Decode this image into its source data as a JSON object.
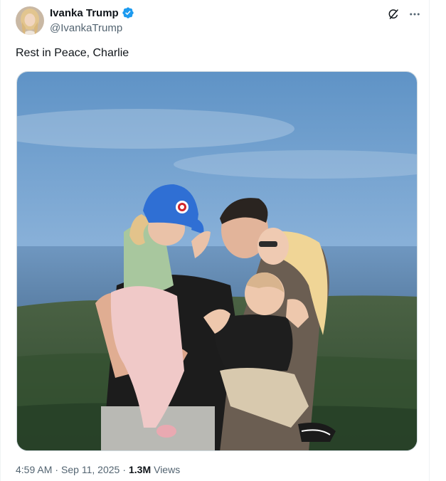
{
  "tweet": {
    "author": {
      "display_name": "Ivanka Trump",
      "handle": "@IvankaTrump",
      "verified": true
    },
    "text": "Rest in Peace, Charlie",
    "meta": {
      "time": "4:59 AM",
      "date": "Sep 11, 2025",
      "views_count": "1.3M",
      "views_label": "Views",
      "separator": "·"
    }
  },
  "icons": {
    "verified": "verified-badge-icon",
    "grok": "grok-icon",
    "more": "more-icon"
  },
  "colors": {
    "verified_blue": "#1d9bf0",
    "text_primary": "#0f1419",
    "text_secondary": "#536471",
    "border": "#cfd9de"
  }
}
